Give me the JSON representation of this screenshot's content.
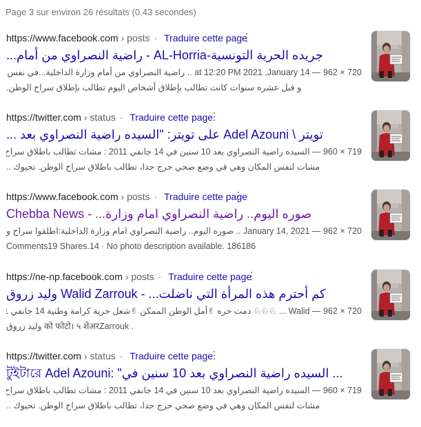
{
  "stats_text": "Page 3 sur environ 26 résultats (0,43 secondes)",
  "results": [
    {
      "url_domain": "https://www.facebook.com",
      "url_path": "posts",
      "translate_label": "Traduire cette page",
      "menu_icon": "more-vert-icon",
      "title": "جريده الحرية التونسية-AL-Horria - راضية النصراوي من أمام...",
      "visited": false,
      "snippet_line1": "720 × 962 — at 12:20 PM 2021 ,January 14 .. راضية النصراوي من أمام وزارة الداخلية...في نفس اليوم",
      "snippet_line2": "و قبل عشره سنوات كانت تطالب بإطلاق أشخاص اليوم تطالب بإطلاق سراح الوطن.",
      "thumbnail": "photo-woman-holding-sign"
    },
    {
      "url_domain": "https://twitter.com",
      "url_path": "status",
      "translate_label": "Traduire cette page",
      "menu_icon": "more-vert-icon",
      "title": "تويتر \\ Adel Azouni على تويتر: \"السيده راضية النصراوي بعد ...",
      "visited": false,
      "snippet_line1": "719 × 960 — السيده راضية النصراوي بعد 10 سنين في 14 جانفي 2011 : مشات تطالب باطلاق سراح حمة واليوم",
      "snippet_line2": "مشات لنفس المكان وهي في وضع صحي حرج جدا، تطالب باطلاق سراح الوطن. تحيوك ..",
      "thumbnail": "photo-woman-holding-sign"
    },
    {
      "url_domain": "https://www.facebook.com",
      "url_path": "posts",
      "translate_label": "Traduire cette page",
      "menu_icon": "more-vert-icon",
      "title": "صوره اليوم.. راضية النصراوي امام وزارة... - Chebba News",
      "visited": true,
      "snippet_line1": "720 × 962 — 2021 ,January 14 .. صوره اليوم.. راضية النصراوي امام وزارة الداخلية:اطلقوا سراح وطني.",
      "snippet_line2": "Comments19 Shares.14 · No photo description available. 186186",
      "thumbnail": "photo-woman-holding-sign"
    },
    {
      "url_domain": "https://ne-np.facebook.com",
      "url_path": "posts",
      "translate_label": "Traduire cette page",
      "menu_icon": "more-vert-icon",
      "title": "كم أحترم هذه المرأة التي ناضلت... - Walid Zarrouk وليد زروق",
      "visited": false,
      "snippet_line1": "720 × 962 — Walid ... ♘♘♘ دمت حره ✌أمل الوطن الممكن ✌شعل حرية كرامة وطنية 14 جانفي 2021",
      "snippet_line2": ". को फोटो। ५ शेअरZarrouk وليد زروق",
      "thumbnail": "photo-woman-holding-sign"
    },
    {
      "url_domain": "https://twitter.com",
      "url_path": "status",
      "translate_label": "Traduire cette page",
      "menu_icon": "more-vert-icon",
      "title": "টুইটারে Adel Azouni: \"السيده راضية النصراوي بعد 10 سنين في ...",
      "visited": false,
      "snippet_line1": "719 × 960 — السيده راضية النصراوي بعد 10 سنين في 14 جانفي 2011 : مشات تطالب باطلاق سراح حمة واليوم",
      "snippet_line2": "مشات لنفس المكان وهي في وضع صحي حرج جدا، تطالب باطلاق سراح الوطن. تحيوك ..",
      "thumbnail": "photo-woman-holding-sign"
    }
  ]
}
